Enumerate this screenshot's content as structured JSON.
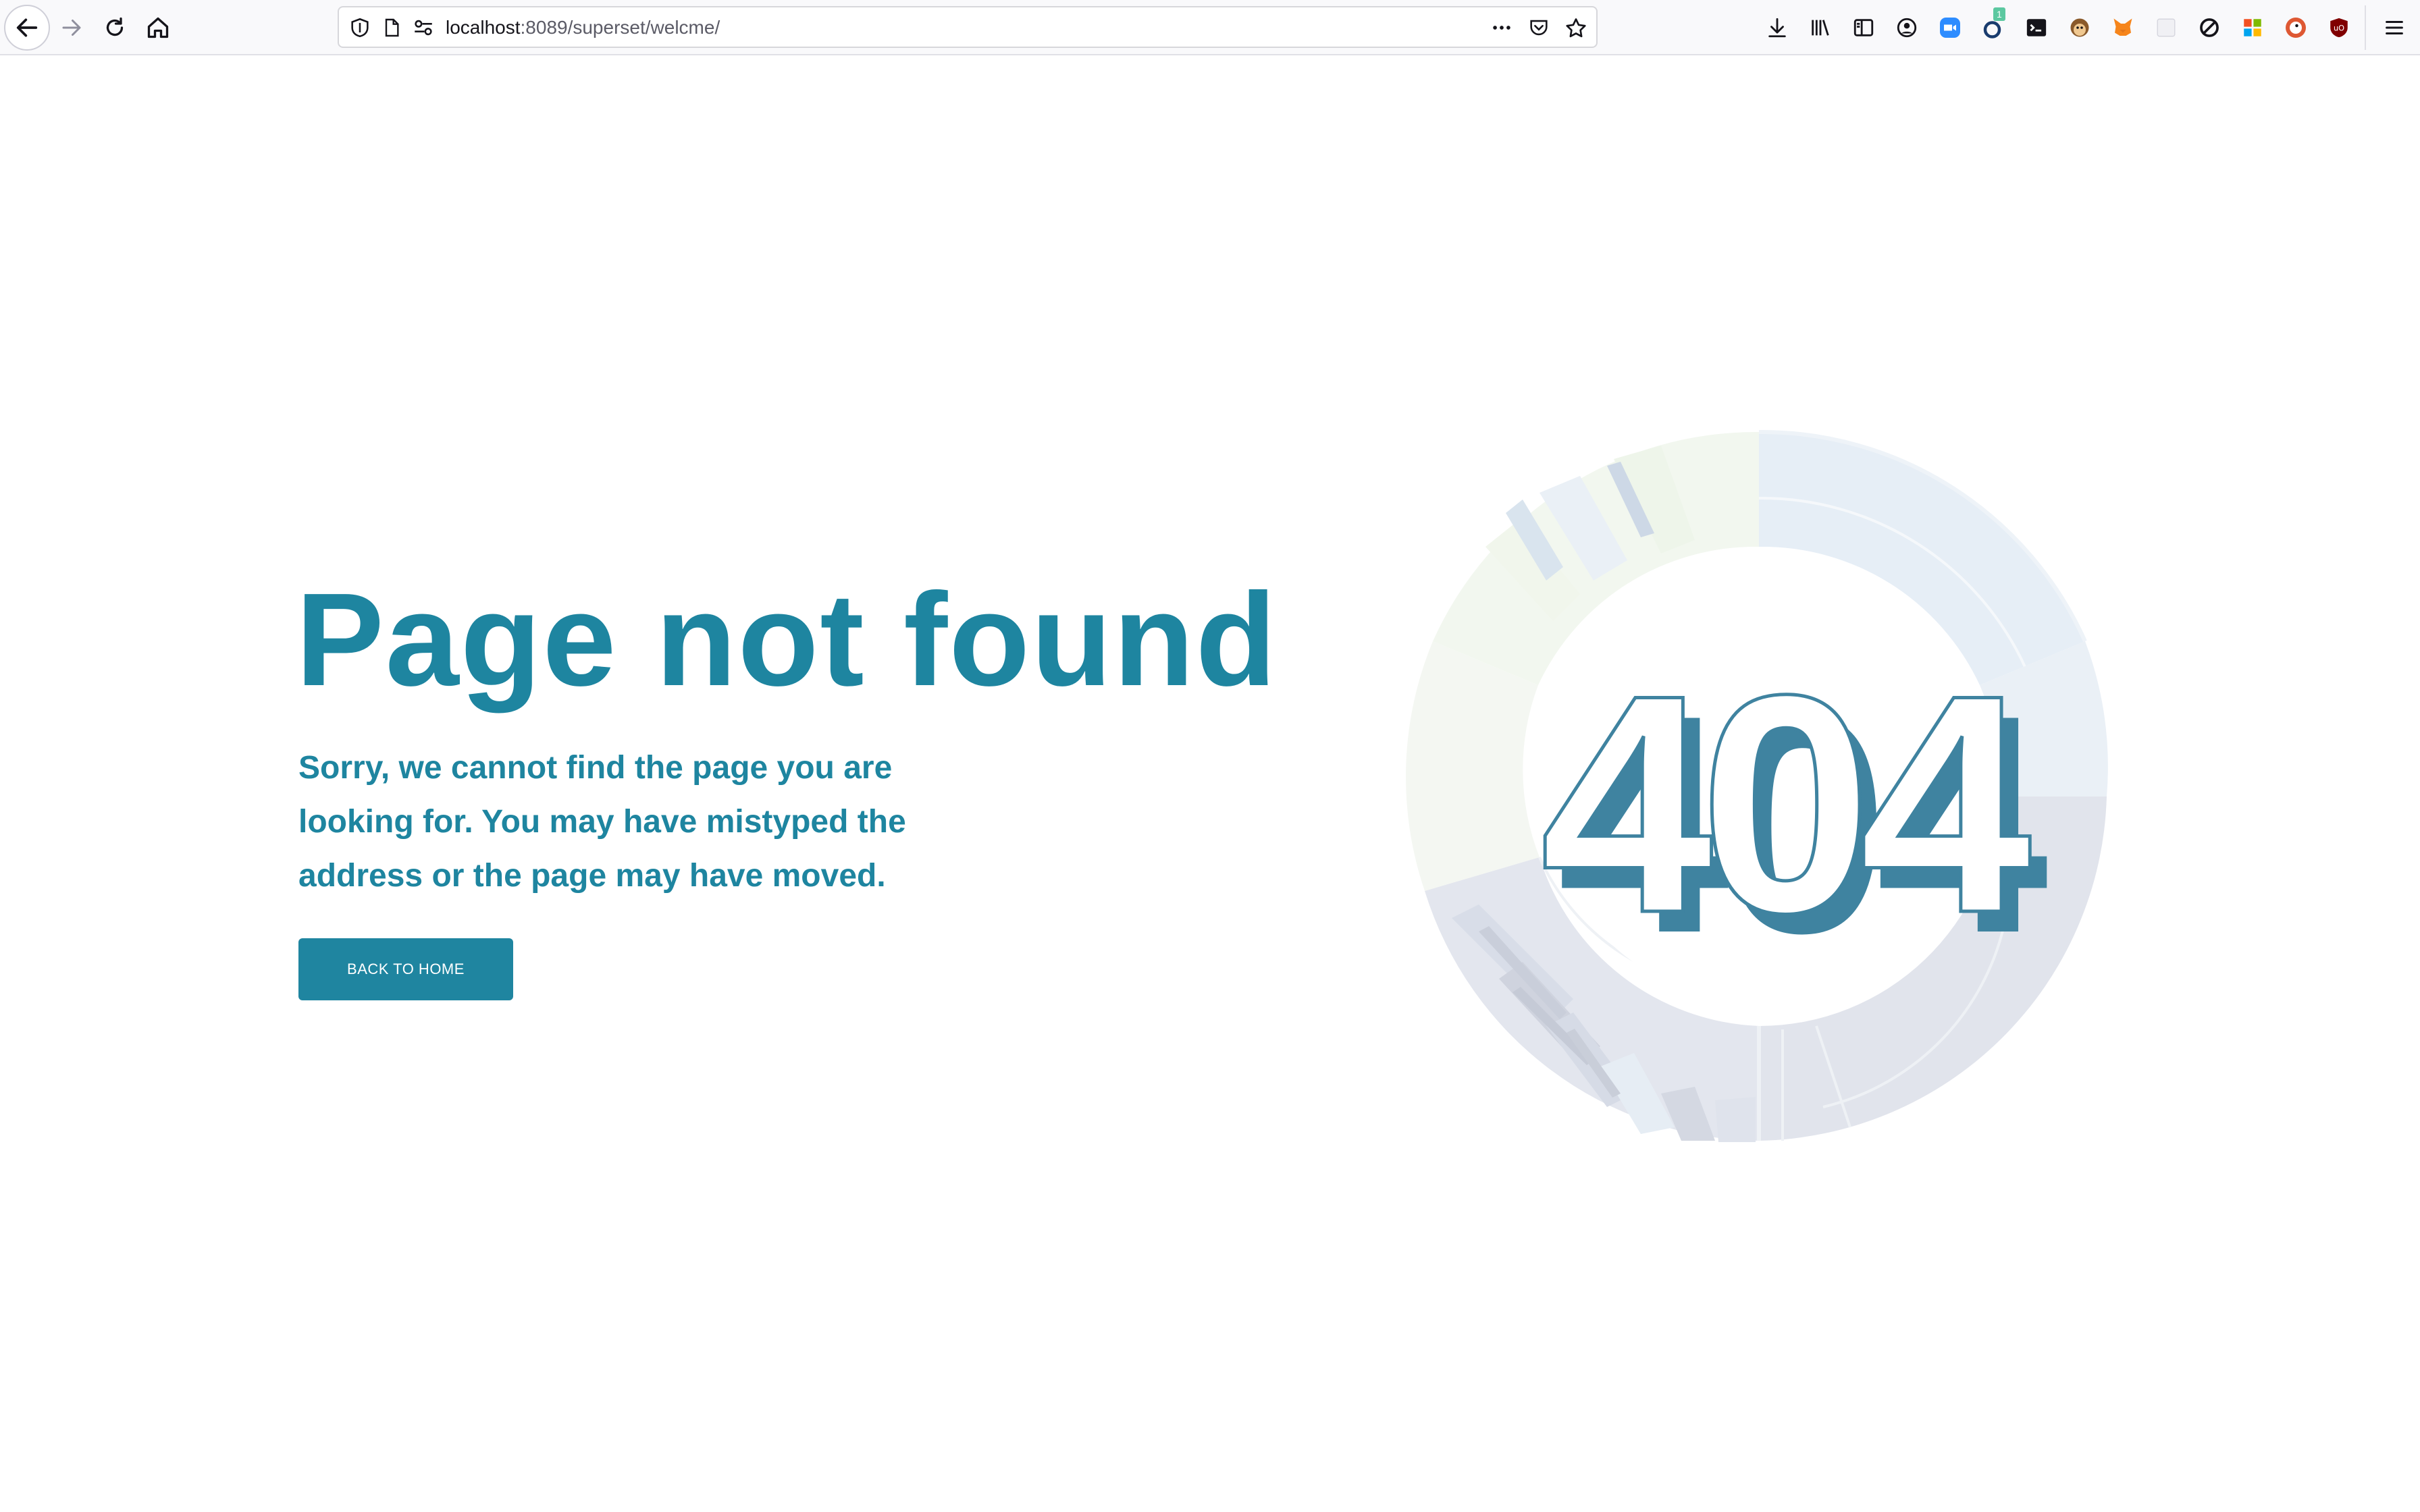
{
  "browser": {
    "url_host": "localhost",
    "url_path": ":8089/superset/welcme/",
    "nav_icons": [
      "back-icon",
      "forward-icon",
      "reload-icon",
      "home-icon"
    ],
    "url_icons": [
      "shield-icon",
      "page-icon",
      "permissions-icon",
      "more-icon",
      "pocket-icon",
      "bookmark-star-icon"
    ],
    "extension_icons": [
      "download-icon",
      "library-icon",
      "sidebar-icon",
      "account-icon",
      "zoom-icon",
      "extension-badge-icon",
      "terminal-icon",
      "monkey-icon",
      "metamask-icon",
      "blank-extension-icon",
      "block-icon",
      "grid-icon",
      "duckduckgo-icon",
      "ublock-icon",
      "hamburger-menu-icon"
    ],
    "extension_badge": "1"
  },
  "page": {
    "title": "Page not found",
    "message_line1": "Sorry, we cannot find the page you are",
    "message_line2": "looking for. You may have mistyped the",
    "message_line3": "address or the page may have moved.",
    "button_label": "BACK TO HOME",
    "illustration_text": "404"
  },
  "colors": {
    "accent": "#1e85a0",
    "digit_shadow": "#3f83a0",
    "ring_top": "#e8f0f6",
    "ring_bottom": "#e2e5ee"
  }
}
